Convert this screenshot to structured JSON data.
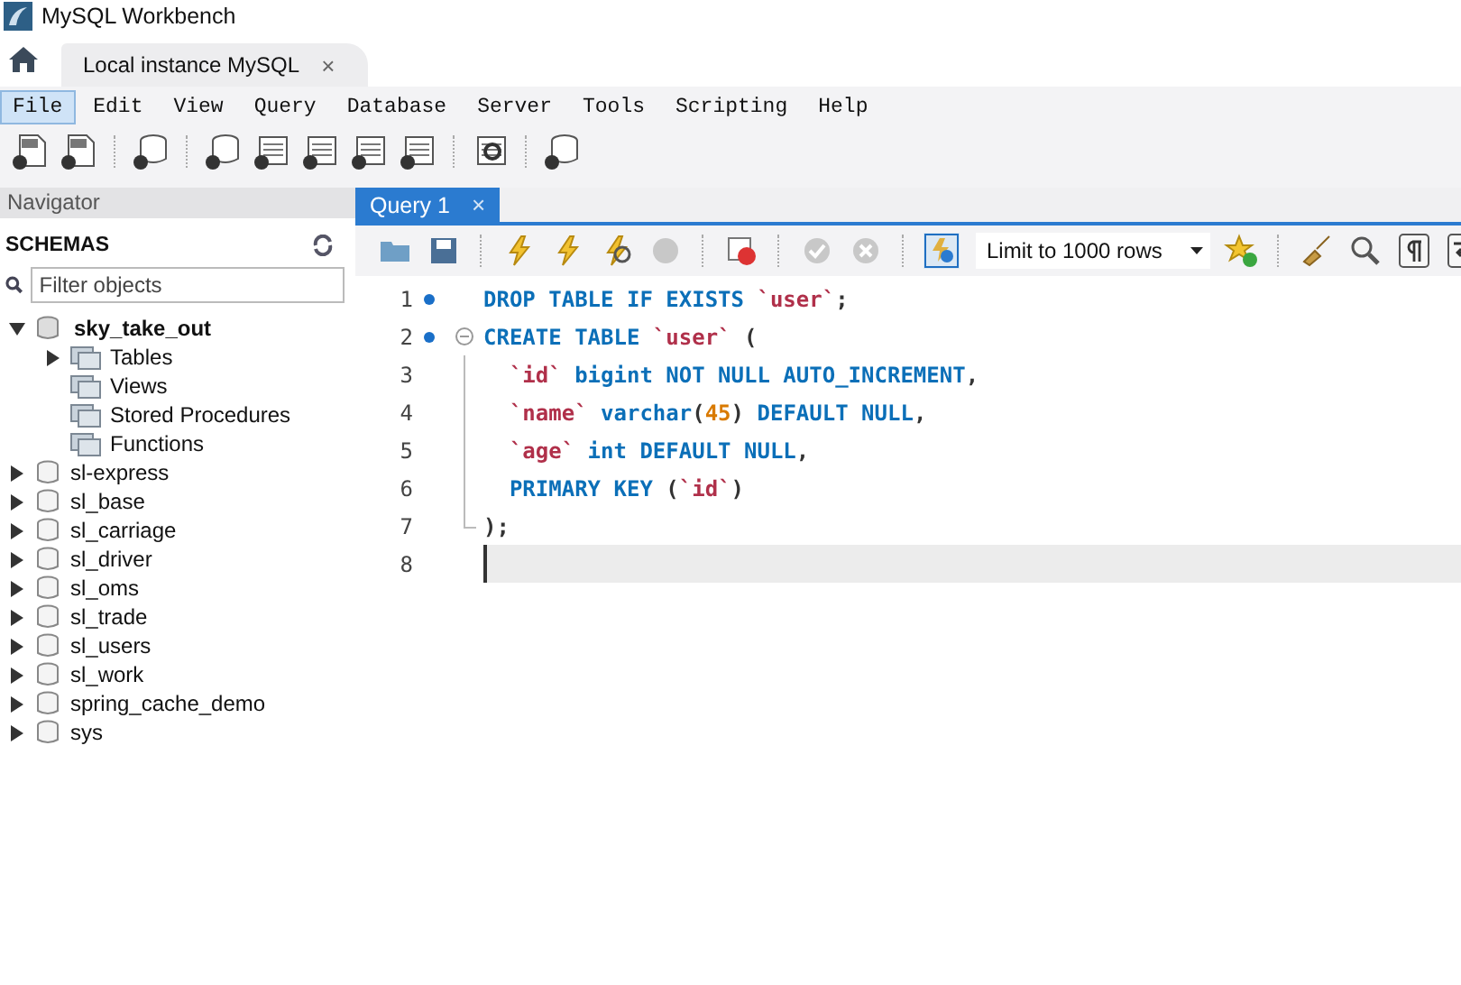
{
  "window": {
    "title": "MySQL Workbench"
  },
  "connection_tabs": [
    {
      "label": "Local instance MySQL",
      "close": "×",
      "selected": true
    }
  ],
  "menu": [
    {
      "label": "File",
      "selected": true
    },
    {
      "label": "Edit",
      "selected": false
    },
    {
      "label": "View",
      "selected": false
    },
    {
      "label": "Query",
      "selected": false
    },
    {
      "label": "Database",
      "selected": false
    },
    {
      "label": "Server",
      "selected": false
    },
    {
      "label": "Tools",
      "selected": false
    },
    {
      "label": "Scripting",
      "selected": false
    },
    {
      "label": "Help",
      "selected": false
    }
  ],
  "navigator": {
    "title": "Navigator",
    "section": "SCHEMAS",
    "filter": {
      "placeholder": "Filter objects"
    },
    "schemas": [
      {
        "name": "sky_take_out",
        "expanded": true,
        "default": true,
        "children": [
          {
            "name": "Tables",
            "expandable": true
          },
          {
            "name": "Views",
            "expandable": false
          },
          {
            "name": "Stored Procedures",
            "expandable": false
          },
          {
            "name": "Functions",
            "expandable": false
          }
        ]
      },
      {
        "name": "sl-express",
        "expanded": false,
        "default": false
      },
      {
        "name": "sl_base",
        "expanded": false,
        "default": false
      },
      {
        "name": "sl_carriage",
        "expanded": false,
        "default": false
      },
      {
        "name": "sl_driver",
        "expanded": false,
        "default": false
      },
      {
        "name": "sl_oms",
        "expanded": false,
        "default": false
      },
      {
        "name": "sl_trade",
        "expanded": false,
        "default": false
      },
      {
        "name": "sl_users",
        "expanded": false,
        "default": false
      },
      {
        "name": "sl_work",
        "expanded": false,
        "default": false
      },
      {
        "name": "spring_cache_demo",
        "expanded": false,
        "default": false
      },
      {
        "name": "sys",
        "expanded": false,
        "default": false
      }
    ]
  },
  "query_tabs": [
    {
      "label": "Query 1",
      "close": "×",
      "selected": true
    }
  ],
  "query_toolbar": {
    "limit": "Limit to 1000 rows"
  },
  "editor": {
    "lines": [
      {
        "number": "1",
        "statement": true,
        "kind": "plain",
        "current": false,
        "tokens": [
          {
            "kind": "kw",
            "text": "DROP TABLE IF EXISTS "
          },
          {
            "kind": "ident",
            "text": "`user`"
          },
          {
            "kind": "punct",
            "text": ";"
          }
        ]
      },
      {
        "number": "2",
        "statement": true,
        "kind": "fold-start",
        "current": false,
        "tokens": [
          {
            "kind": "kw",
            "text": "CREATE TABLE "
          },
          {
            "kind": "ident",
            "text": "`user`"
          },
          {
            "kind": "punct",
            "text": " ("
          }
        ]
      },
      {
        "number": "3",
        "statement": false,
        "kind": "fold-body",
        "current": false,
        "tokens": [
          {
            "kind": "ident",
            "text": "  `id`"
          },
          {
            "kind": "kw",
            "text": " bigint NOT NULL AUTO_INCREMENT"
          },
          {
            "kind": "punct",
            "text": ","
          }
        ]
      },
      {
        "number": "4",
        "statement": false,
        "kind": "fold-body",
        "current": false,
        "tokens": [
          {
            "kind": "ident",
            "text": "  `name`"
          },
          {
            "kind": "kw",
            "text": " varchar"
          },
          {
            "kind": "punct",
            "text": "("
          },
          {
            "kind": "num",
            "text": "45"
          },
          {
            "kind": "punct",
            "text": ")"
          },
          {
            "kind": "kw",
            "text": " DEFAULT NULL"
          },
          {
            "kind": "punct",
            "text": ","
          }
        ]
      },
      {
        "number": "5",
        "statement": false,
        "kind": "fold-body",
        "current": false,
        "tokens": [
          {
            "kind": "ident",
            "text": "  `age`"
          },
          {
            "kind": "kw",
            "text": " int DEFAULT NULL"
          },
          {
            "kind": "punct",
            "text": ","
          }
        ]
      },
      {
        "number": "6",
        "statement": false,
        "kind": "fold-body",
        "current": false,
        "tokens": [
          {
            "kind": "kw",
            "text": "  PRIMARY KEY "
          },
          {
            "kind": "punct",
            "text": "("
          },
          {
            "kind": "ident",
            "text": "`id`"
          },
          {
            "kind": "punct",
            "text": ")"
          }
        ]
      },
      {
        "number": "7",
        "statement": false,
        "kind": "fold-end",
        "current": false,
        "tokens": [
          {
            "kind": "punct",
            "text": ");"
          }
        ]
      },
      {
        "number": "8",
        "statement": false,
        "kind": "plain",
        "current": true
      }
    ]
  }
}
